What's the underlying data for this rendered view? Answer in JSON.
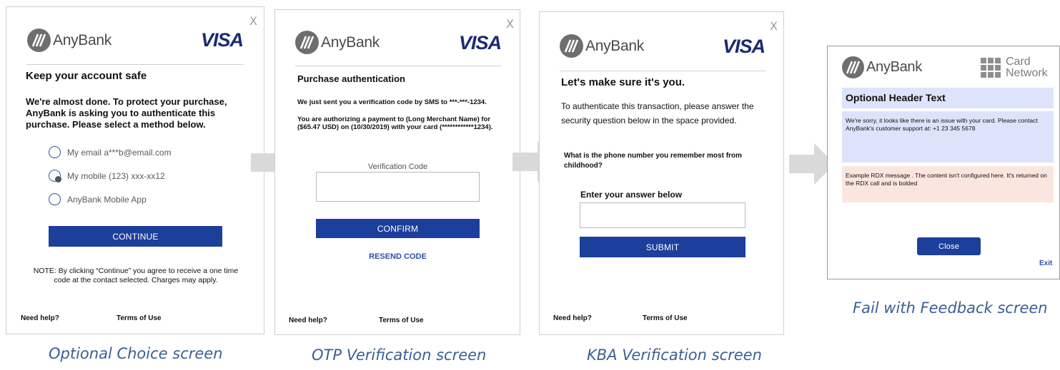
{
  "brand": {
    "name": "AnyBank",
    "network": "VISA"
  },
  "close_glyph": "X",
  "screens": {
    "choice": {
      "caption": "Optional Choice screen",
      "title": "Keep your account safe",
      "intro": "We're almost done. To protect your purchase, AnyBank is asking you to authenticate this purchase. Please select a method below.",
      "options": [
        {
          "label": "My email a***b@email.com"
        },
        {
          "label": "My mobile (123) xxx-xx12"
        },
        {
          "label": "AnyBank Mobile App"
        }
      ],
      "button": "CONTINUE",
      "note": "NOTE: By clicking “Continue” you agree to receive a one time code at the contact selected. Charges may apply.",
      "help": "Need help?",
      "terms": "Terms of Use"
    },
    "otp": {
      "caption": "OTP Verification screen",
      "title": "Purchase authentication",
      "line1": "We just sent you a verification code by SMS to ***-***-1234.",
      "line2": "You are authorizing a payment to (Long Merchant Name) for ($65.47 USD) on (10/30/2019) with your card (************1234).",
      "field_label": "Verification Code",
      "button": "CONFIRM",
      "resend": "RESEND CODE",
      "help": "Need help?",
      "terms": "Terms of Use"
    },
    "kba": {
      "caption": "KBA Verification screen",
      "title": "Let's make sure it's you.",
      "intro": "To authenticate this transaction, please answer the security question below in the space provided.",
      "question": "What is the phone number you remember most from childhood?",
      "field_label": "Enter your answer below",
      "button": "SUBMIT",
      "help": "Need help?",
      "terms": "Terms of Use"
    },
    "fail": {
      "caption": "Fail with Feedback screen",
      "network_line1": "Card",
      "network_line2": "Network",
      "header": "Optional Header Text",
      "message": "We're sorry, it looks like there is an issue with your card. Please contact AnyBank's customer support at: +1 23 345 5678",
      "rdx": "Example RDX message . The content isn't configured here. It's returned on the RDX call and is bolded",
      "button": "Close",
      "exit": "Exit"
    }
  },
  "colors": {
    "button": "#1d3f9c",
    "visa": "#1a2a72",
    "caption": "#3a5f96",
    "header_bg": "#dde3fb",
    "message_bg": "#dde3fb",
    "rdx_bg": "#fbe6df",
    "arrow": "#d9d9d9"
  }
}
